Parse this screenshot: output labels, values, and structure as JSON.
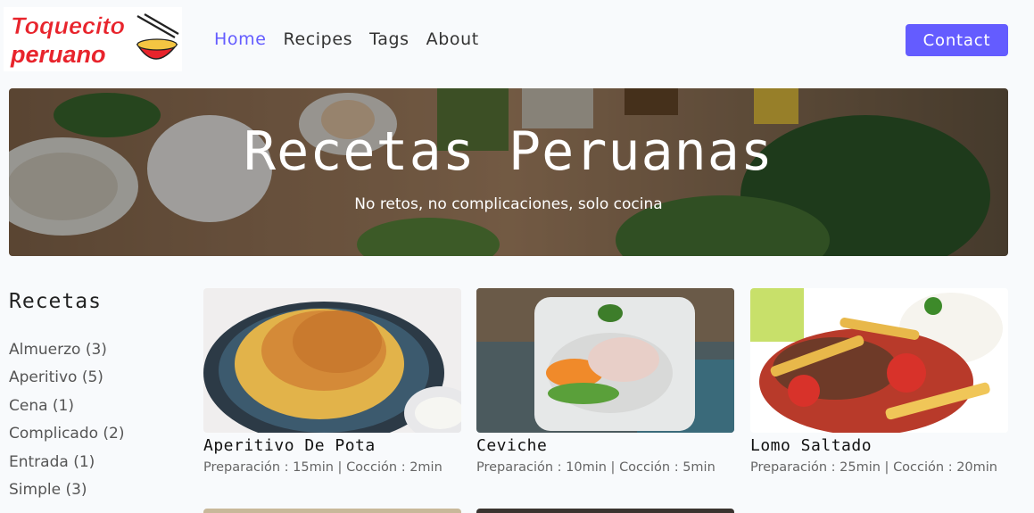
{
  "logo": {
    "line1": "Toquecito",
    "line2": "peruano",
    "icon": "bowl-with-chopsticks-icon"
  },
  "nav": {
    "links": [
      {
        "label": "Home",
        "active": true
      },
      {
        "label": "Recipes",
        "active": false
      },
      {
        "label": "Tags",
        "active": false
      },
      {
        "label": "About",
        "active": false
      }
    ],
    "contact_label": "Contact"
  },
  "hero": {
    "title": "Recetas Peruanas",
    "subtitle": "No retos, no complicaciones, solo cocina"
  },
  "sidebar": {
    "title": "Recetas",
    "items": [
      {
        "label": "Almuerzo (3)"
      },
      {
        "label": "Aperitivo (5)"
      },
      {
        "label": "Cena (1)"
      },
      {
        "label": "Complicado (2)"
      },
      {
        "label": "Entrada (1)"
      },
      {
        "label": "Simple (3)"
      }
    ]
  },
  "recipes": [
    {
      "title": "Aperitivo De Pota",
      "prep": "Preparación : 15min",
      "cook": "Cocción : 2min"
    },
    {
      "title": "Ceviche",
      "prep": "Preparación : 10min",
      "cook": "Cocción : 5min"
    },
    {
      "title": "Lomo Saltado",
      "prep": "Preparación : 25min",
      "cook": "Cocción : 20min"
    }
  ],
  "colors": {
    "accent": "#645cff",
    "logo_red": "#e8242c"
  }
}
